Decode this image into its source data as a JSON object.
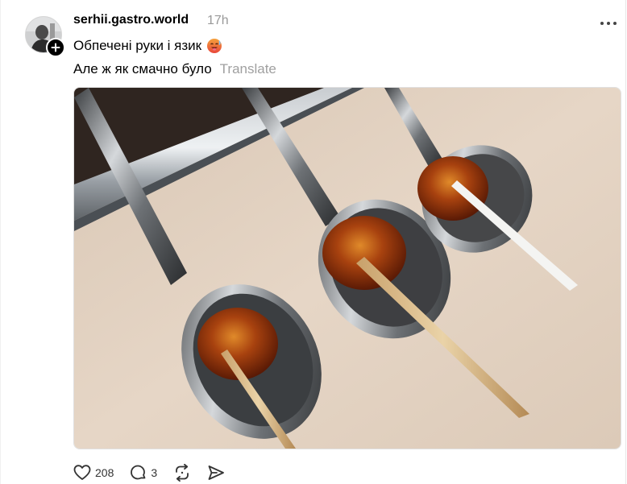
{
  "post": {
    "username": "serhii.gastro.world",
    "time": "17h",
    "text_line1": "Обпечені руки і язик",
    "text_line2": "Але ж як смачно було",
    "translate_label": "Translate",
    "emoji": "hot-face-emoji"
  },
  "actions": {
    "likes": "208",
    "comments": "3"
  },
  "icons": {
    "more": "more-icon",
    "follow": "plus-icon",
    "like": "heart-icon",
    "comment": "comment-icon",
    "repost": "repost-icon",
    "share": "share-icon"
  },
  "colors": {
    "muted": "#999999",
    "translate": "#a0a0a0",
    "icon": "#333333"
  }
}
